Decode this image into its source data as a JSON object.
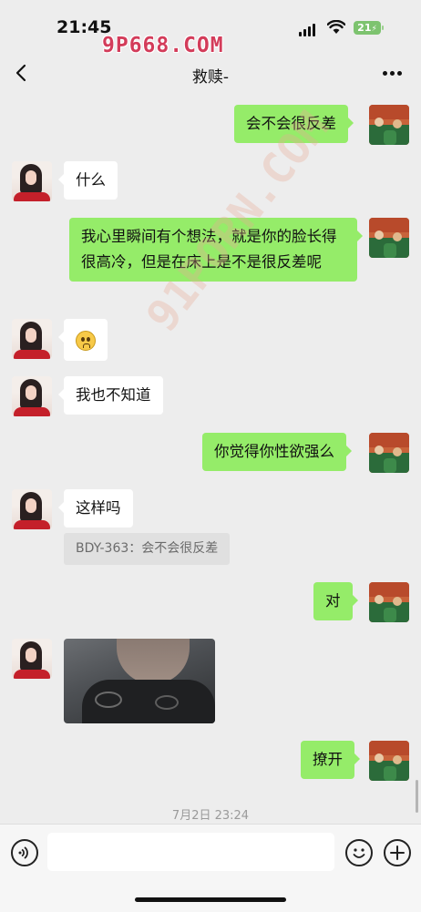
{
  "status_bar": {
    "time": "21:45",
    "battery": "21"
  },
  "watermarks": {
    "top": "9P668.COM",
    "diagonal": "91PORN.COM"
  },
  "header": {
    "title": "救赎-"
  },
  "messages": [
    {
      "from": "self",
      "text": "会不会很反差"
    },
    {
      "from": "other",
      "text": "什么"
    },
    {
      "from": "self",
      "text": "我心里瞬间有个想法，就是你的脸长得很高冷，但是在床上是不是很反差呢"
    },
    {
      "from": "other",
      "type": "emoji",
      "text": "",
      "icon": "flushed-face-emoji"
    },
    {
      "from": "other",
      "text": "我也不知道"
    },
    {
      "from": "self",
      "text": "你觉得你性欲强么"
    },
    {
      "from": "other",
      "text": "这样吗",
      "quote": "BDY-363：会不会很反差"
    },
    {
      "from": "self",
      "text": "对"
    },
    {
      "from": "other",
      "type": "image",
      "text": ""
    },
    {
      "from": "self",
      "text": "撩开"
    }
  ],
  "timestamp": "7月2日 23:24",
  "input_bar": {
    "value": "",
    "placeholder": ""
  },
  "icons": {
    "back": "chevron-left-icon",
    "more": "more-dots-icon",
    "voice": "voice-icon",
    "emoji": "emoji-icon",
    "plus": "plus-icon"
  },
  "colors": {
    "background": "#ededed",
    "bubble_in": "#ffffff",
    "bubble_out": "#95ec69",
    "watermark": "#d33c5a",
    "battery": "#7dc36f"
  }
}
